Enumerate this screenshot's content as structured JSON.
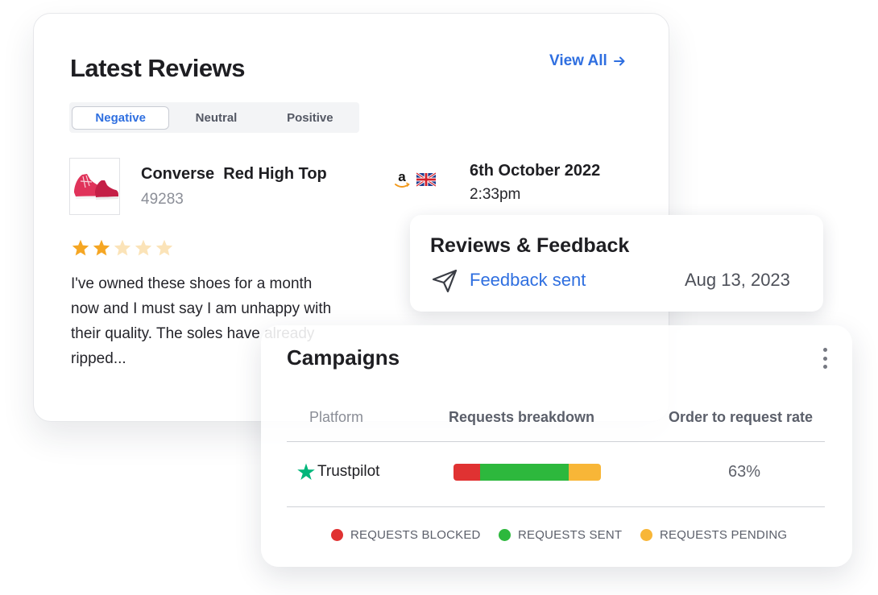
{
  "reviews_card": {
    "title": "Latest Reviews",
    "view_all": "View All",
    "tabs": [
      "Negative",
      "Neutral",
      "Positive"
    ],
    "active_tab": "Negative",
    "product": {
      "name": "Converse  Red High Top",
      "id": "49283",
      "image_icon": "red-sneaker-icon"
    },
    "marketplace_icon": "amazon-icon",
    "country_icon": "uk-flag-icon",
    "date": "6th October 2022",
    "time": "2:33pm",
    "rating": 2,
    "rating_max": 5,
    "text_lines": [
      "I've owned these shoes for a month",
      "now and I must say I am unhappy with",
      "their quality. The soles have already",
      "ripped..."
    ]
  },
  "feedback_card": {
    "title": "Reviews & Feedback",
    "status_icon": "paper-plane-icon",
    "status": "Feedback sent",
    "date": "Aug 13, 2023"
  },
  "campaigns_card": {
    "title": "Campaigns",
    "columns": [
      "Platform",
      "Requests breakdown",
      "Order to request rate"
    ],
    "row": {
      "platform": "Trustpilot",
      "rate": "63%",
      "breakdown": [
        {
          "label": "REQUESTS BLOCKED",
          "fraction": 0.18,
          "color": "#e03232"
        },
        {
          "label": "REQUESTS SENT",
          "fraction": 0.6,
          "color": "#2db83d"
        },
        {
          "label": "REQUESTS PENDING",
          "fraction": 0.22,
          "color": "#f8b637"
        }
      ]
    },
    "legend": [
      "REQUESTS BLOCKED",
      "REQUESTS SENT",
      "REQUESTS PENDING"
    ]
  },
  "colors": {
    "accent": "#2f6fe0",
    "star": "#f5a623",
    "trustpilot": "#00b67a"
  }
}
